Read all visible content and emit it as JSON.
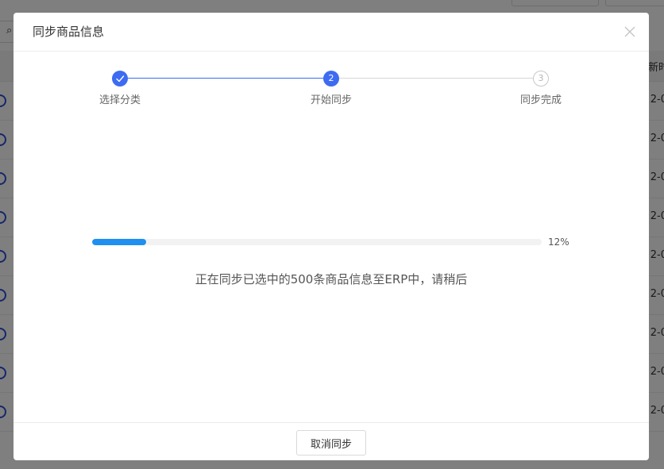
{
  "background": {
    "search_icon": "search-icon",
    "header_partial": "新时",
    "row_date_partials": [
      "2-0",
      "2-0",
      "2-0",
      "2-0",
      "2-0",
      "2-0",
      "2-0",
      "2-0",
      "2-0"
    ]
  },
  "modal": {
    "title": "同步商品信息",
    "close_icon": "close-icon"
  },
  "steps": [
    {
      "label": "选择分类",
      "status": "done",
      "icon": "check-icon"
    },
    {
      "label": "开始同步",
      "status": "active",
      "number": "2"
    },
    {
      "label": "同步完成",
      "status": "pending",
      "number": "3"
    }
  ],
  "progress": {
    "percent": 12,
    "percent_text": "12%",
    "message": "正在同步已选中的500条商品信息至ERP中，请稍后"
  },
  "footer": {
    "cancel_label": "取消同步"
  },
  "colors": {
    "accent": "#3d6bf2",
    "progress": "#1f8ff0"
  }
}
